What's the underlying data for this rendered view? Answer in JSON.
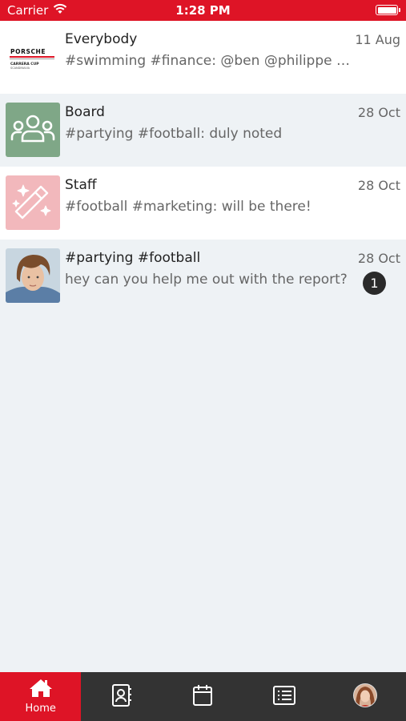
{
  "status_bar": {
    "carrier": "Carrier",
    "time": "1:28 PM"
  },
  "conversations": [
    {
      "title": "Everybody",
      "preview": "#swimming #finance: @ben @philippe you a...",
      "date": "11 Aug",
      "avatar_icon": "porsche-carrera-cup-logo",
      "logo_text": "CARRERA CUP"
    },
    {
      "title": "Board",
      "preview": "#partying #football: duly noted",
      "date": "28 Oct",
      "avatar_icon": "group-icon",
      "avatar_color": "#7fa787"
    },
    {
      "title": "Staff",
      "preview": "#football #marketing: will be there!",
      "date": "28 Oct",
      "avatar_icon": "magic-wand-icon",
      "avatar_color": "#f2b8bc"
    },
    {
      "title": "#partying #football",
      "preview": "hey can you help me out with the report?",
      "date": "28 Oct",
      "avatar_icon": "user-photo",
      "unread": "1"
    }
  ],
  "tabbar": {
    "home_label": "Home",
    "accent_color": "#de1426",
    "icons": [
      "home-icon",
      "contacts-icon",
      "calendar-icon",
      "list-icon",
      "profile-avatar"
    ]
  }
}
